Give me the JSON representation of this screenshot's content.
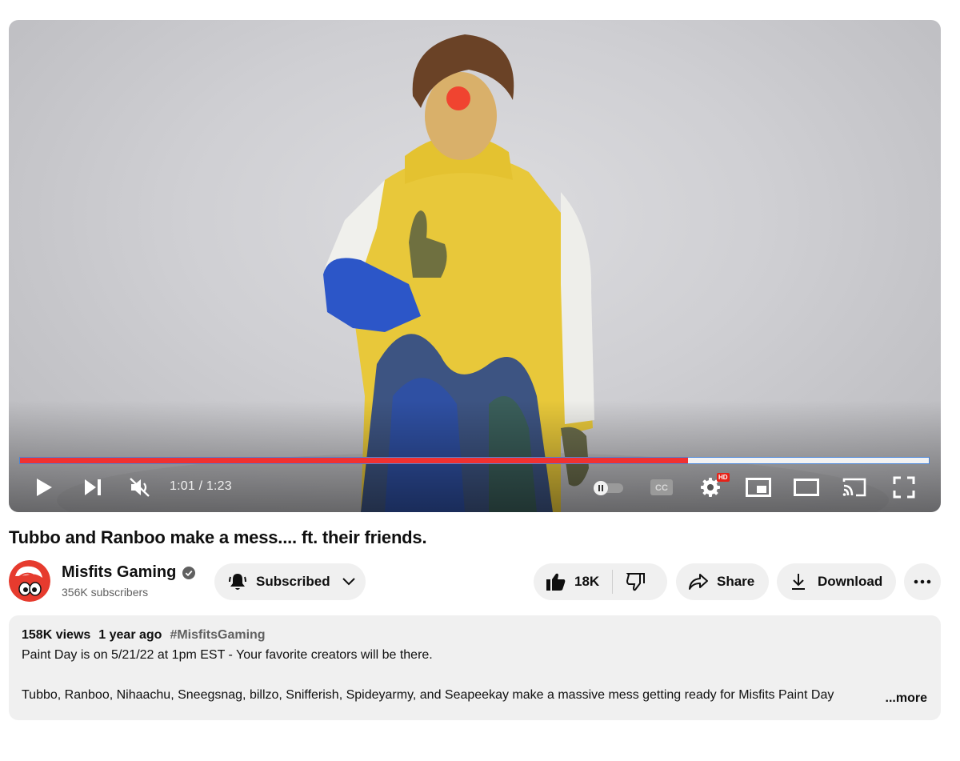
{
  "player": {
    "time_display": "1:01 / 1:23",
    "progress_played_fraction": 0.735,
    "progress_buffered_fraction": 1.0,
    "hd_badge": "HD",
    "controls": [
      "play-icon",
      "next-icon",
      "mute-icon",
      "autoplay-toggle",
      "captions-icon",
      "settings-icon",
      "miniplayer-icon",
      "theater-icon",
      "cast-icon",
      "fullscreen-icon"
    ],
    "accent": "#f03131"
  },
  "video": {
    "title": "Tubbo and Ranboo make a mess.... ft. their friends."
  },
  "channel": {
    "name": "Misfits Gaming",
    "subscribers": "356K subscribers",
    "verified_icon": "verified-check-icon",
    "avatar_color": "#e63b2e"
  },
  "actions": {
    "subscribe_label": "Subscribed",
    "like_count": "18K",
    "share_label": "Share",
    "download_label": "Download"
  },
  "description": {
    "views": "158K views",
    "age": "1 year ago",
    "hashtag": "#MisfitsGaming",
    "line1": "Paint Day is on 5/21/22 at 1pm EST - Your favorite creators will be there.",
    "line2": "Tubbo, Ranboo, Nihaachu, Sneegsnag, billzo, Snifferish, Spideyarmy, and Seapeekay make a massive mess getting ready for Misfits Paint Day",
    "more_label": "...more"
  }
}
